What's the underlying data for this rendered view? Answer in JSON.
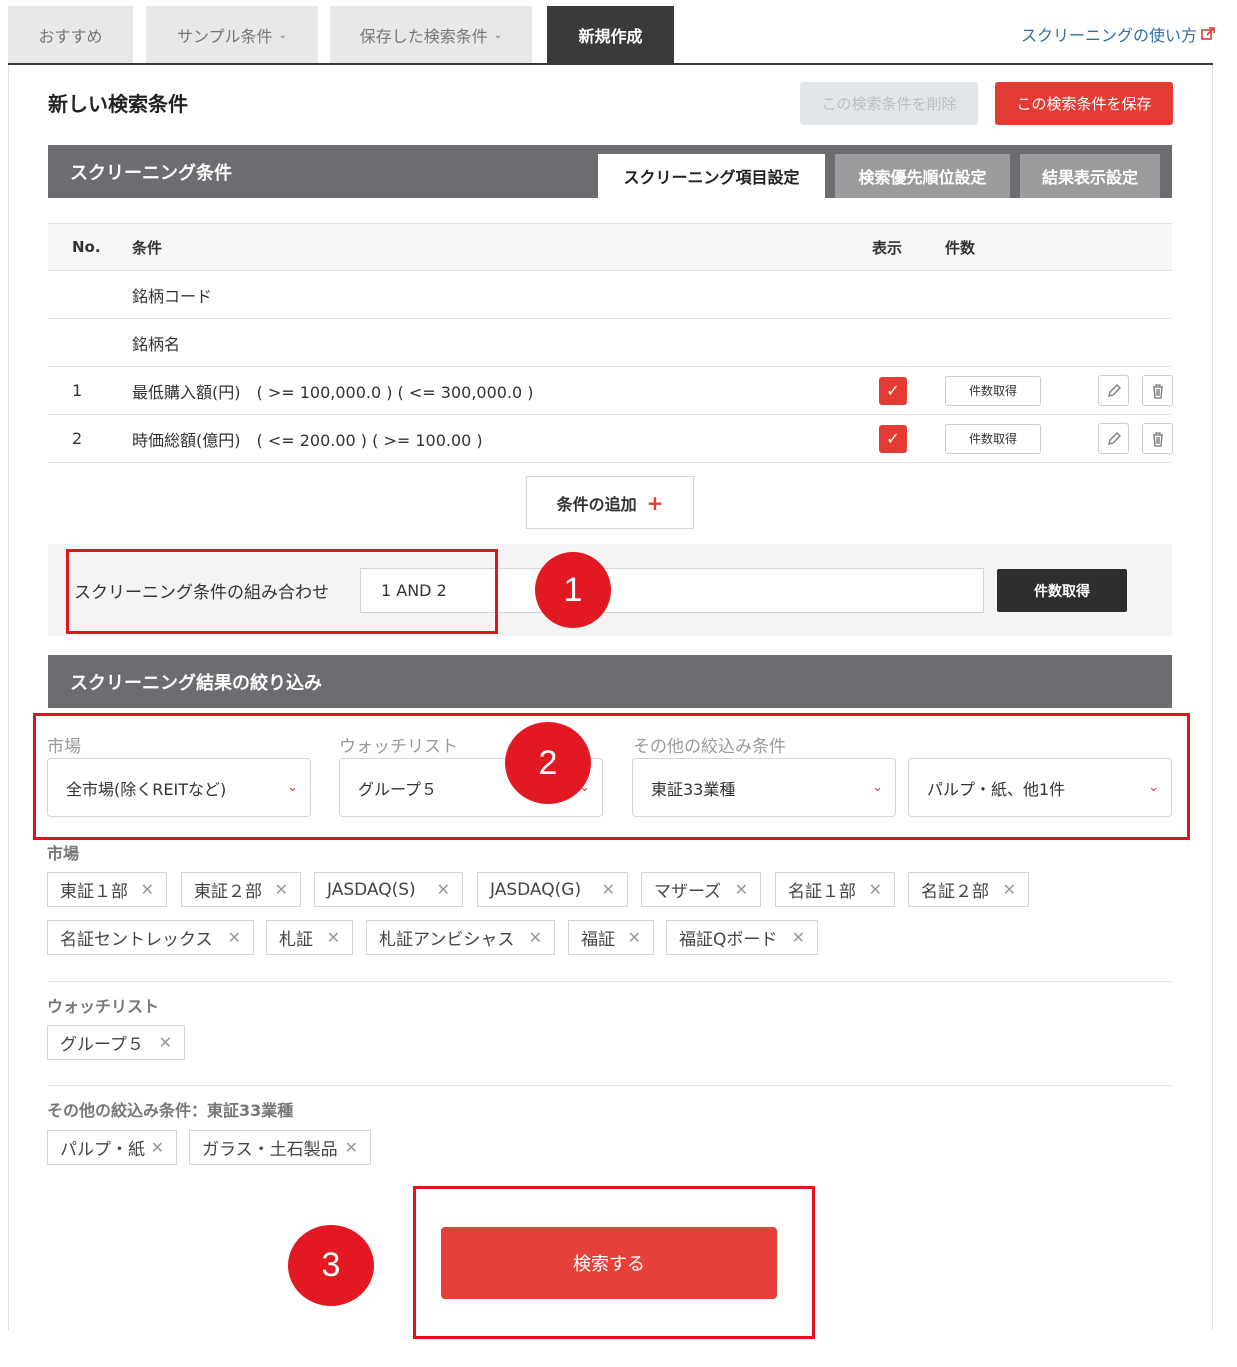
{
  "top_tabs": [
    {
      "label": "おすすめ"
    },
    {
      "label": "サンプル条件"
    },
    {
      "label": "保存した検索条件"
    },
    {
      "label": "新規作成"
    }
  ],
  "help_link": "スクリーニングの使い方",
  "page_title": "新しい検索条件",
  "buttons": {
    "delete": "この検索条件を削除",
    "save": "この検索条件を保存",
    "add_condition": "条件の追加",
    "count": "件数取得",
    "search": "検索する"
  },
  "section1": {
    "title": "スクリーニング条件",
    "tabs": [
      "スクリーニング項目設定",
      "検索優先順位設定",
      "結果表示設定"
    ]
  },
  "table": {
    "headers": {
      "no": "No.",
      "cond": "条件",
      "show": "表示",
      "count": "件数"
    },
    "rows": [
      {
        "no": "",
        "cond": "銘柄コード"
      },
      {
        "no": "",
        "cond": "銘柄名"
      },
      {
        "no": "1",
        "cond": "最低購入額(円)　( >= 100,000.0 ) ( <= 300,000.0 )",
        "shown": true
      },
      {
        "no": "2",
        "cond": "時価総額(億円)　( <= 200.00 ) ( >= 100.00 )",
        "shown": true
      }
    ]
  },
  "combination": {
    "label": "スクリーニング条件の組み合わせ",
    "value": "1 AND 2"
  },
  "section2": {
    "title": "スクリーニング結果の絞り込み",
    "filters": [
      {
        "label": "市場",
        "selected": "全市場(除くREITなど)"
      },
      {
        "label": "ウォッチリスト",
        "selected": "グループ５"
      },
      {
        "label": "その他の絞込み条件",
        "selected": "東証33業種"
      },
      {
        "label": "",
        "selected": "パルプ・紙、他1件"
      }
    ]
  },
  "tag_groups": {
    "market": {
      "title": "市場",
      "tags": [
        "東証１部",
        "東証２部",
        "JASDAQ(S)",
        "JASDAQ(G)",
        "マザーズ",
        "名証１部",
        "名証２部",
        "名証セントレックス",
        "札証",
        "札証アンビシャス",
        "福証",
        "福証Qボード"
      ]
    },
    "watchlist": {
      "title": "ウォッチリスト",
      "tags": [
        "グループ５"
      ]
    },
    "other": {
      "title": "その他の絞込み条件：東証33業種",
      "tags": [
        "パルプ・紙",
        "ガラス・土石製品"
      ]
    }
  },
  "annotations": [
    "1",
    "2",
    "3"
  ],
  "colors": {
    "accent": "#e43c34",
    "annotation": "#e0141c",
    "section_bar": "#6b6d70"
  }
}
